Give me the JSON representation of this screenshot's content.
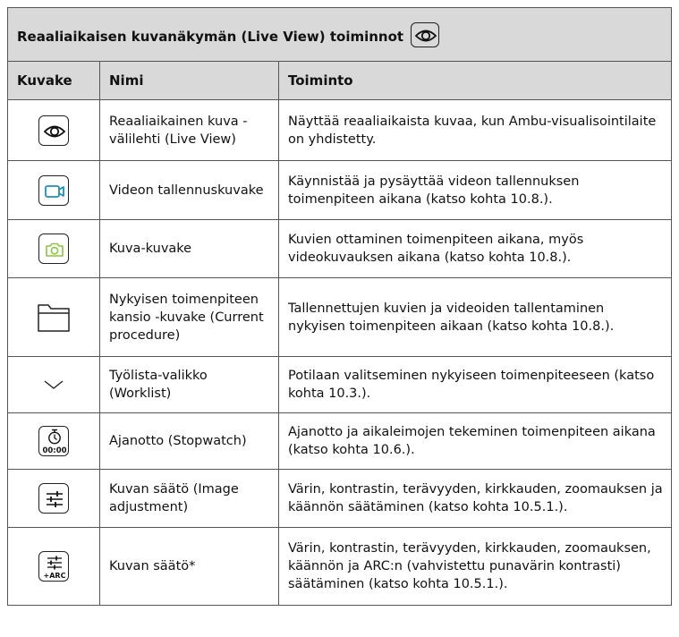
{
  "table": {
    "title": "Reaaliaikaisen kuvanäkymän (Live View) toiminnot",
    "title_icon": "eye-icon",
    "headers": {
      "icon": "Kuvake",
      "name": "Nimi",
      "function": "Toiminto"
    },
    "rows": [
      {
        "icon": "eye-icon",
        "name": "Reaaliaikainen kuva -välilehti (Live View)",
        "function": "Näyttää reaaliaikaista kuvaa, kun Ambu-visualisointilaite on yhdistetty."
      },
      {
        "icon": "video-camera-icon",
        "icon_color": "#1a8fc9",
        "name": "Videon tallennuskuvake",
        "function": "Käynnistää ja pysäyttää videon tallennuksen toimenpiteen aikana (katso kohta 10.8.)."
      },
      {
        "icon": "camera-icon",
        "icon_color": "#8cc63f",
        "name": "Kuva-kuvake",
        "function": "Kuvien ottaminen toimenpiteen aikana, myös videokuvauksen aikana (katso kohta 10.8.)."
      },
      {
        "icon": "folder-icon",
        "name": "Nykyisen toimenpiteen kansio -kuvake (Current procedure)",
        "function": "Tallennettujen kuvien ja videoiden tallentaminen nykyisen toimenpiteen aikaan (katso kohta 10.8.)."
      },
      {
        "icon": "chevron-down-icon",
        "name": "Työlista-valikko (Worklist)",
        "function": "Potilaan valitseminen nykyiseen toimenpiteeseen (katso kohta 10.3.)."
      },
      {
        "icon": "stopwatch-icon",
        "icon_text": "00:00",
        "name": "Ajanotto (Stopwatch)",
        "function": "Ajanotto ja aikaleimojen tekeminen toimenpiteen aikana (katso kohta 10.6.)."
      },
      {
        "icon": "sliders-icon",
        "name": "Kuvan säätö (Image adjustment)",
        "function": "Värin, kontrastin, terävyyden, kirkkauden, zoomauksen ja käännön säätäminen (katso kohta 10.5.1.)."
      },
      {
        "icon": "sliders-arc-icon",
        "icon_text": "+ARC",
        "name": "Kuvan säätö*",
        "function": "Värin, kontrastin, terävyyden, kirkkauden, zoomauksen, käännön ja ARC:n (vahvistettu punavärin kontrasti) säätäminen (katso kohta 10.5.1.)."
      }
    ]
  }
}
